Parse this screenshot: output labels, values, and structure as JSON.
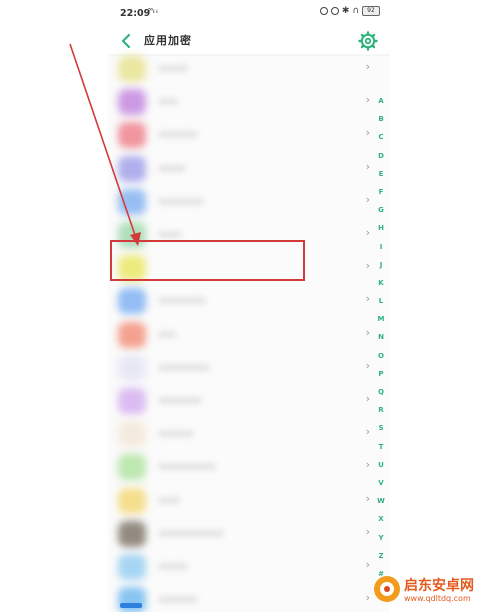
{
  "status_bar": {
    "time": "22:09",
    "network": "⁵⁶ᵢₗ ᵢᵢ",
    "battery": "92"
  },
  "header": {
    "title": "应用加密"
  },
  "colors": {
    "accent": "#2fb37e",
    "highlight_box": "#d23b3b",
    "arrow": "#d23b3b"
  },
  "rows": [
    {
      "icon_color": "#e9e59a"
    },
    {
      "icon_color": "#c892e2"
    },
    {
      "icon_color": "#f08c96"
    },
    {
      "icon_color": "#a9a9ec"
    },
    {
      "icon_color": "#8fb9f2"
    },
    {
      "icon_color": "#a9dcb6"
    },
    {
      "icon_color": "#ecea74"
    },
    {
      "icon_color": "#8ab8f4"
    },
    {
      "icon_color": "#f59a86"
    },
    {
      "icon_color": "#e7e6f5"
    },
    {
      "icon_color": "#d8b6f1"
    },
    {
      "icon_color": "#f4e9dc"
    },
    {
      "icon_color": "#b8e6a9"
    },
    {
      "icon_color": "#f6dc86"
    },
    {
      "icon_color": "#8a8276"
    },
    {
      "icon_color": "#9fd2f3"
    },
    {
      "icon_color": "#7ec0f1"
    }
  ],
  "index_letters": [
    "A",
    "B",
    "C",
    "D",
    "E",
    "F",
    "G",
    "H",
    "I",
    "J",
    "K",
    "L",
    "M",
    "N",
    "O",
    "P",
    "Q",
    "R",
    "S",
    "T",
    "U",
    "V",
    "W",
    "X",
    "Y",
    "Z",
    "#"
  ],
  "watermark": {
    "name": "启东安卓网",
    "url": "www.qdltdq.com"
  }
}
